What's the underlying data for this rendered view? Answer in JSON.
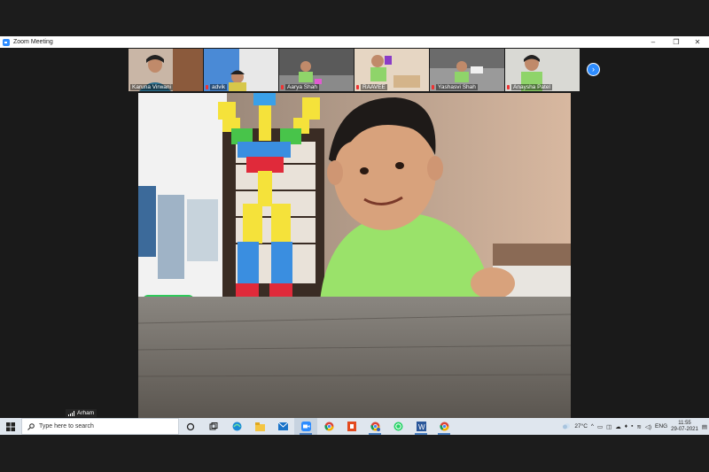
{
  "window": {
    "title": "Zoom Meeting",
    "controls": {
      "minimize": "–",
      "maximize": "❐",
      "close": "✕"
    }
  },
  "participants": [
    {
      "name": "Karuna Virwani",
      "muted": false
    },
    {
      "name": "advik",
      "muted": true
    },
    {
      "name": "Aarya Shah",
      "muted": true
    },
    {
      "name": "RAAVEE",
      "muted": true
    },
    {
      "name": "Yashasvi Shah",
      "muted": true
    },
    {
      "name": "Anaysha Patel",
      "muted": true
    }
  ],
  "next_page_icon": "chevron-right-icon",
  "active_speaker": {
    "name": "Arham"
  },
  "taskbar": {
    "search_placeholder": "Type here to search",
    "pinned_apps": [
      "cortana-icon",
      "task-view-icon",
      "edge-icon",
      "file-explorer-icon",
      "mail-icon",
      "zoom-icon",
      "chrome-icon",
      "office-icon",
      "chrome-profile-icon",
      "whatsapp-icon",
      "word-icon",
      "chrome-alt-icon"
    ],
    "active_app": "zoom-icon",
    "weather": "27°C",
    "language": "ENG",
    "time": "11:55",
    "date": "29-07-2021"
  },
  "colors": {
    "zoom_blue": "#2d8cff",
    "taskbar": "#dfe6ee",
    "background": "#1a1a1a",
    "muted_red": "#e33333"
  }
}
